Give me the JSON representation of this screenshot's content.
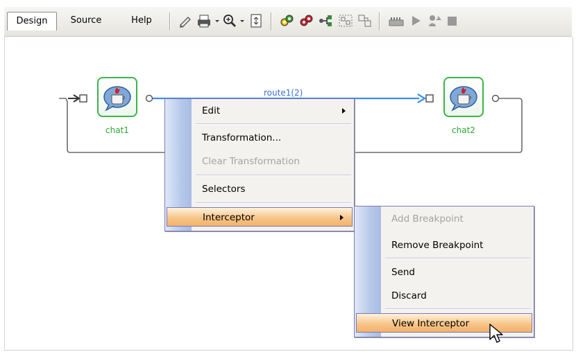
{
  "toolbar": {
    "tabs": [
      {
        "label": "Design",
        "active": true
      },
      {
        "label": "Source",
        "active": false
      },
      {
        "label": "Help",
        "active": false
      }
    ],
    "icons": [
      "pencil-icon",
      "print-icon",
      "dropdown-arrow-icon",
      "zoom-icon",
      "dropdown-arrow-icon",
      "fit-page-icon",
      "link-add-icon",
      "link-remove-icon",
      "connector-icon",
      "group-icon",
      "ungroup-icon",
      "breakpoint-icon",
      "play-icon",
      "step-icon",
      "stop-icon"
    ]
  },
  "diagram": {
    "nodes": [
      {
        "id": "chat1",
        "label": "chat1"
      },
      {
        "id": "chat2",
        "label": "chat2"
      }
    ],
    "route_label": "route1(2)"
  },
  "context_menu": {
    "items": [
      {
        "label": "Edit",
        "submenu": true,
        "disabled": false
      },
      {
        "label": "Transformation...",
        "submenu": false,
        "disabled": false
      },
      {
        "label": "Clear Transformation",
        "submenu": false,
        "disabled": true
      },
      {
        "label": "Selectors",
        "submenu": false,
        "disabled": false
      },
      {
        "label": "Interceptor",
        "submenu": true,
        "disabled": false,
        "selected": true
      }
    ]
  },
  "submenu": {
    "items": [
      {
        "label": "Add Breakpoint",
        "disabled": true
      },
      {
        "label": "Remove Breakpoint",
        "disabled": false
      },
      {
        "label": "Send",
        "disabled": false
      },
      {
        "label": "Discard",
        "disabled": false
      },
      {
        "label": "View Interceptor",
        "disabled": false,
        "selected": true
      }
    ]
  },
  "colors": {
    "node_border": "#39b54a",
    "node_label": "#2aa830",
    "wire": "#3c8ee8",
    "menu_border": "#7b78b8",
    "highlight": "#f3b26b"
  }
}
